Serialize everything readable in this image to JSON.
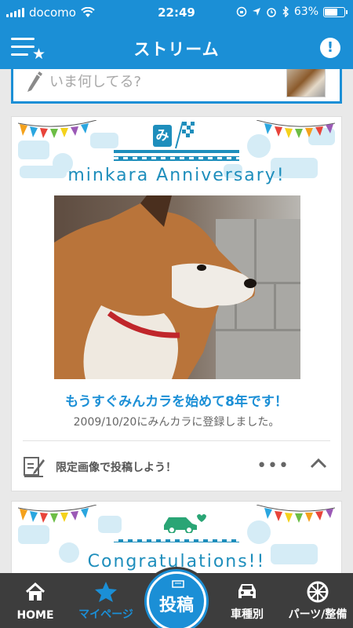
{
  "status_bar": {
    "carrier": "docomo",
    "time": "22:49",
    "battery": "63%",
    "battery_level": 0.63
  },
  "nav": {
    "title": "ストリーム"
  },
  "composer": {
    "placeholder": "いま何してる?"
  },
  "cards": [
    {
      "banner_title": "minkara Anniversary!",
      "logo_text": "み",
      "headline": "もうすぐみんカラを始めて8年です！",
      "subline": "2009/10/20にみんカラに登録しました。",
      "footer_action": "限定画像で投稿しよう！",
      "more_label": "•••"
    },
    {
      "banner_title": "Congratulations!!"
    }
  ],
  "colors": {
    "brand": "#1b8fd6",
    "accent": "#1e8ebc",
    "tabbar": "#3d3d3d"
  },
  "tabbar": {
    "items": [
      {
        "label": "HOME",
        "icon": "home-icon"
      },
      {
        "label": "マイページ",
        "icon": "star-icon",
        "active": true
      },
      {
        "label": "投稿",
        "icon": "post-icon"
      },
      {
        "label": "車種別",
        "icon": "car-icon"
      },
      {
        "label": "パーツ/整備",
        "icon": "wheel-icon"
      }
    ]
  }
}
